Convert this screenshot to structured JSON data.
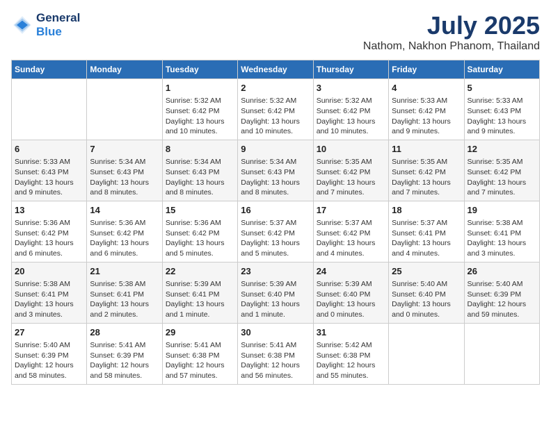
{
  "logo": {
    "line1": "General",
    "line2": "Blue"
  },
  "title": "July 2025",
  "location": "Nathom, Nakhon Phanom, Thailand",
  "days_of_week": [
    "Sunday",
    "Monday",
    "Tuesday",
    "Wednesday",
    "Thursday",
    "Friday",
    "Saturday"
  ],
  "weeks": [
    [
      {
        "day": "",
        "content": ""
      },
      {
        "day": "",
        "content": ""
      },
      {
        "day": "1",
        "content": "Sunrise: 5:32 AM\nSunset: 6:42 PM\nDaylight: 13 hours\nand 10 minutes."
      },
      {
        "day": "2",
        "content": "Sunrise: 5:32 AM\nSunset: 6:42 PM\nDaylight: 13 hours\nand 10 minutes."
      },
      {
        "day": "3",
        "content": "Sunrise: 5:32 AM\nSunset: 6:42 PM\nDaylight: 13 hours\nand 10 minutes."
      },
      {
        "day": "4",
        "content": "Sunrise: 5:33 AM\nSunset: 6:42 PM\nDaylight: 13 hours\nand 9 minutes."
      },
      {
        "day": "5",
        "content": "Sunrise: 5:33 AM\nSunset: 6:43 PM\nDaylight: 13 hours\nand 9 minutes."
      }
    ],
    [
      {
        "day": "6",
        "content": "Sunrise: 5:33 AM\nSunset: 6:43 PM\nDaylight: 13 hours\nand 9 minutes."
      },
      {
        "day": "7",
        "content": "Sunrise: 5:34 AM\nSunset: 6:43 PM\nDaylight: 13 hours\nand 8 minutes."
      },
      {
        "day": "8",
        "content": "Sunrise: 5:34 AM\nSunset: 6:43 PM\nDaylight: 13 hours\nand 8 minutes."
      },
      {
        "day": "9",
        "content": "Sunrise: 5:34 AM\nSunset: 6:43 PM\nDaylight: 13 hours\nand 8 minutes."
      },
      {
        "day": "10",
        "content": "Sunrise: 5:35 AM\nSunset: 6:42 PM\nDaylight: 13 hours\nand 7 minutes."
      },
      {
        "day": "11",
        "content": "Sunrise: 5:35 AM\nSunset: 6:42 PM\nDaylight: 13 hours\nand 7 minutes."
      },
      {
        "day": "12",
        "content": "Sunrise: 5:35 AM\nSunset: 6:42 PM\nDaylight: 13 hours\nand 7 minutes."
      }
    ],
    [
      {
        "day": "13",
        "content": "Sunrise: 5:36 AM\nSunset: 6:42 PM\nDaylight: 13 hours\nand 6 minutes."
      },
      {
        "day": "14",
        "content": "Sunrise: 5:36 AM\nSunset: 6:42 PM\nDaylight: 13 hours\nand 6 minutes."
      },
      {
        "day": "15",
        "content": "Sunrise: 5:36 AM\nSunset: 6:42 PM\nDaylight: 13 hours\nand 5 minutes."
      },
      {
        "day": "16",
        "content": "Sunrise: 5:37 AM\nSunset: 6:42 PM\nDaylight: 13 hours\nand 5 minutes."
      },
      {
        "day": "17",
        "content": "Sunrise: 5:37 AM\nSunset: 6:42 PM\nDaylight: 13 hours\nand 4 minutes."
      },
      {
        "day": "18",
        "content": "Sunrise: 5:37 AM\nSunset: 6:41 PM\nDaylight: 13 hours\nand 4 minutes."
      },
      {
        "day": "19",
        "content": "Sunrise: 5:38 AM\nSunset: 6:41 PM\nDaylight: 13 hours\nand 3 minutes."
      }
    ],
    [
      {
        "day": "20",
        "content": "Sunrise: 5:38 AM\nSunset: 6:41 PM\nDaylight: 13 hours\nand 3 minutes."
      },
      {
        "day": "21",
        "content": "Sunrise: 5:38 AM\nSunset: 6:41 PM\nDaylight: 13 hours\nand 2 minutes."
      },
      {
        "day": "22",
        "content": "Sunrise: 5:39 AM\nSunset: 6:41 PM\nDaylight: 13 hours\nand 1 minute."
      },
      {
        "day": "23",
        "content": "Sunrise: 5:39 AM\nSunset: 6:40 PM\nDaylight: 13 hours\nand 1 minute."
      },
      {
        "day": "24",
        "content": "Sunrise: 5:39 AM\nSunset: 6:40 PM\nDaylight: 13 hours\nand 0 minutes."
      },
      {
        "day": "25",
        "content": "Sunrise: 5:40 AM\nSunset: 6:40 PM\nDaylight: 13 hours\nand 0 minutes."
      },
      {
        "day": "26",
        "content": "Sunrise: 5:40 AM\nSunset: 6:39 PM\nDaylight: 12 hours\nand 59 minutes."
      }
    ],
    [
      {
        "day": "27",
        "content": "Sunrise: 5:40 AM\nSunset: 6:39 PM\nDaylight: 12 hours\nand 58 minutes."
      },
      {
        "day": "28",
        "content": "Sunrise: 5:41 AM\nSunset: 6:39 PM\nDaylight: 12 hours\nand 58 minutes."
      },
      {
        "day": "29",
        "content": "Sunrise: 5:41 AM\nSunset: 6:38 PM\nDaylight: 12 hours\nand 57 minutes."
      },
      {
        "day": "30",
        "content": "Sunrise: 5:41 AM\nSunset: 6:38 PM\nDaylight: 12 hours\nand 56 minutes."
      },
      {
        "day": "31",
        "content": "Sunrise: 5:42 AM\nSunset: 6:38 PM\nDaylight: 12 hours\nand 55 minutes."
      },
      {
        "day": "",
        "content": ""
      },
      {
        "day": "",
        "content": ""
      }
    ]
  ]
}
